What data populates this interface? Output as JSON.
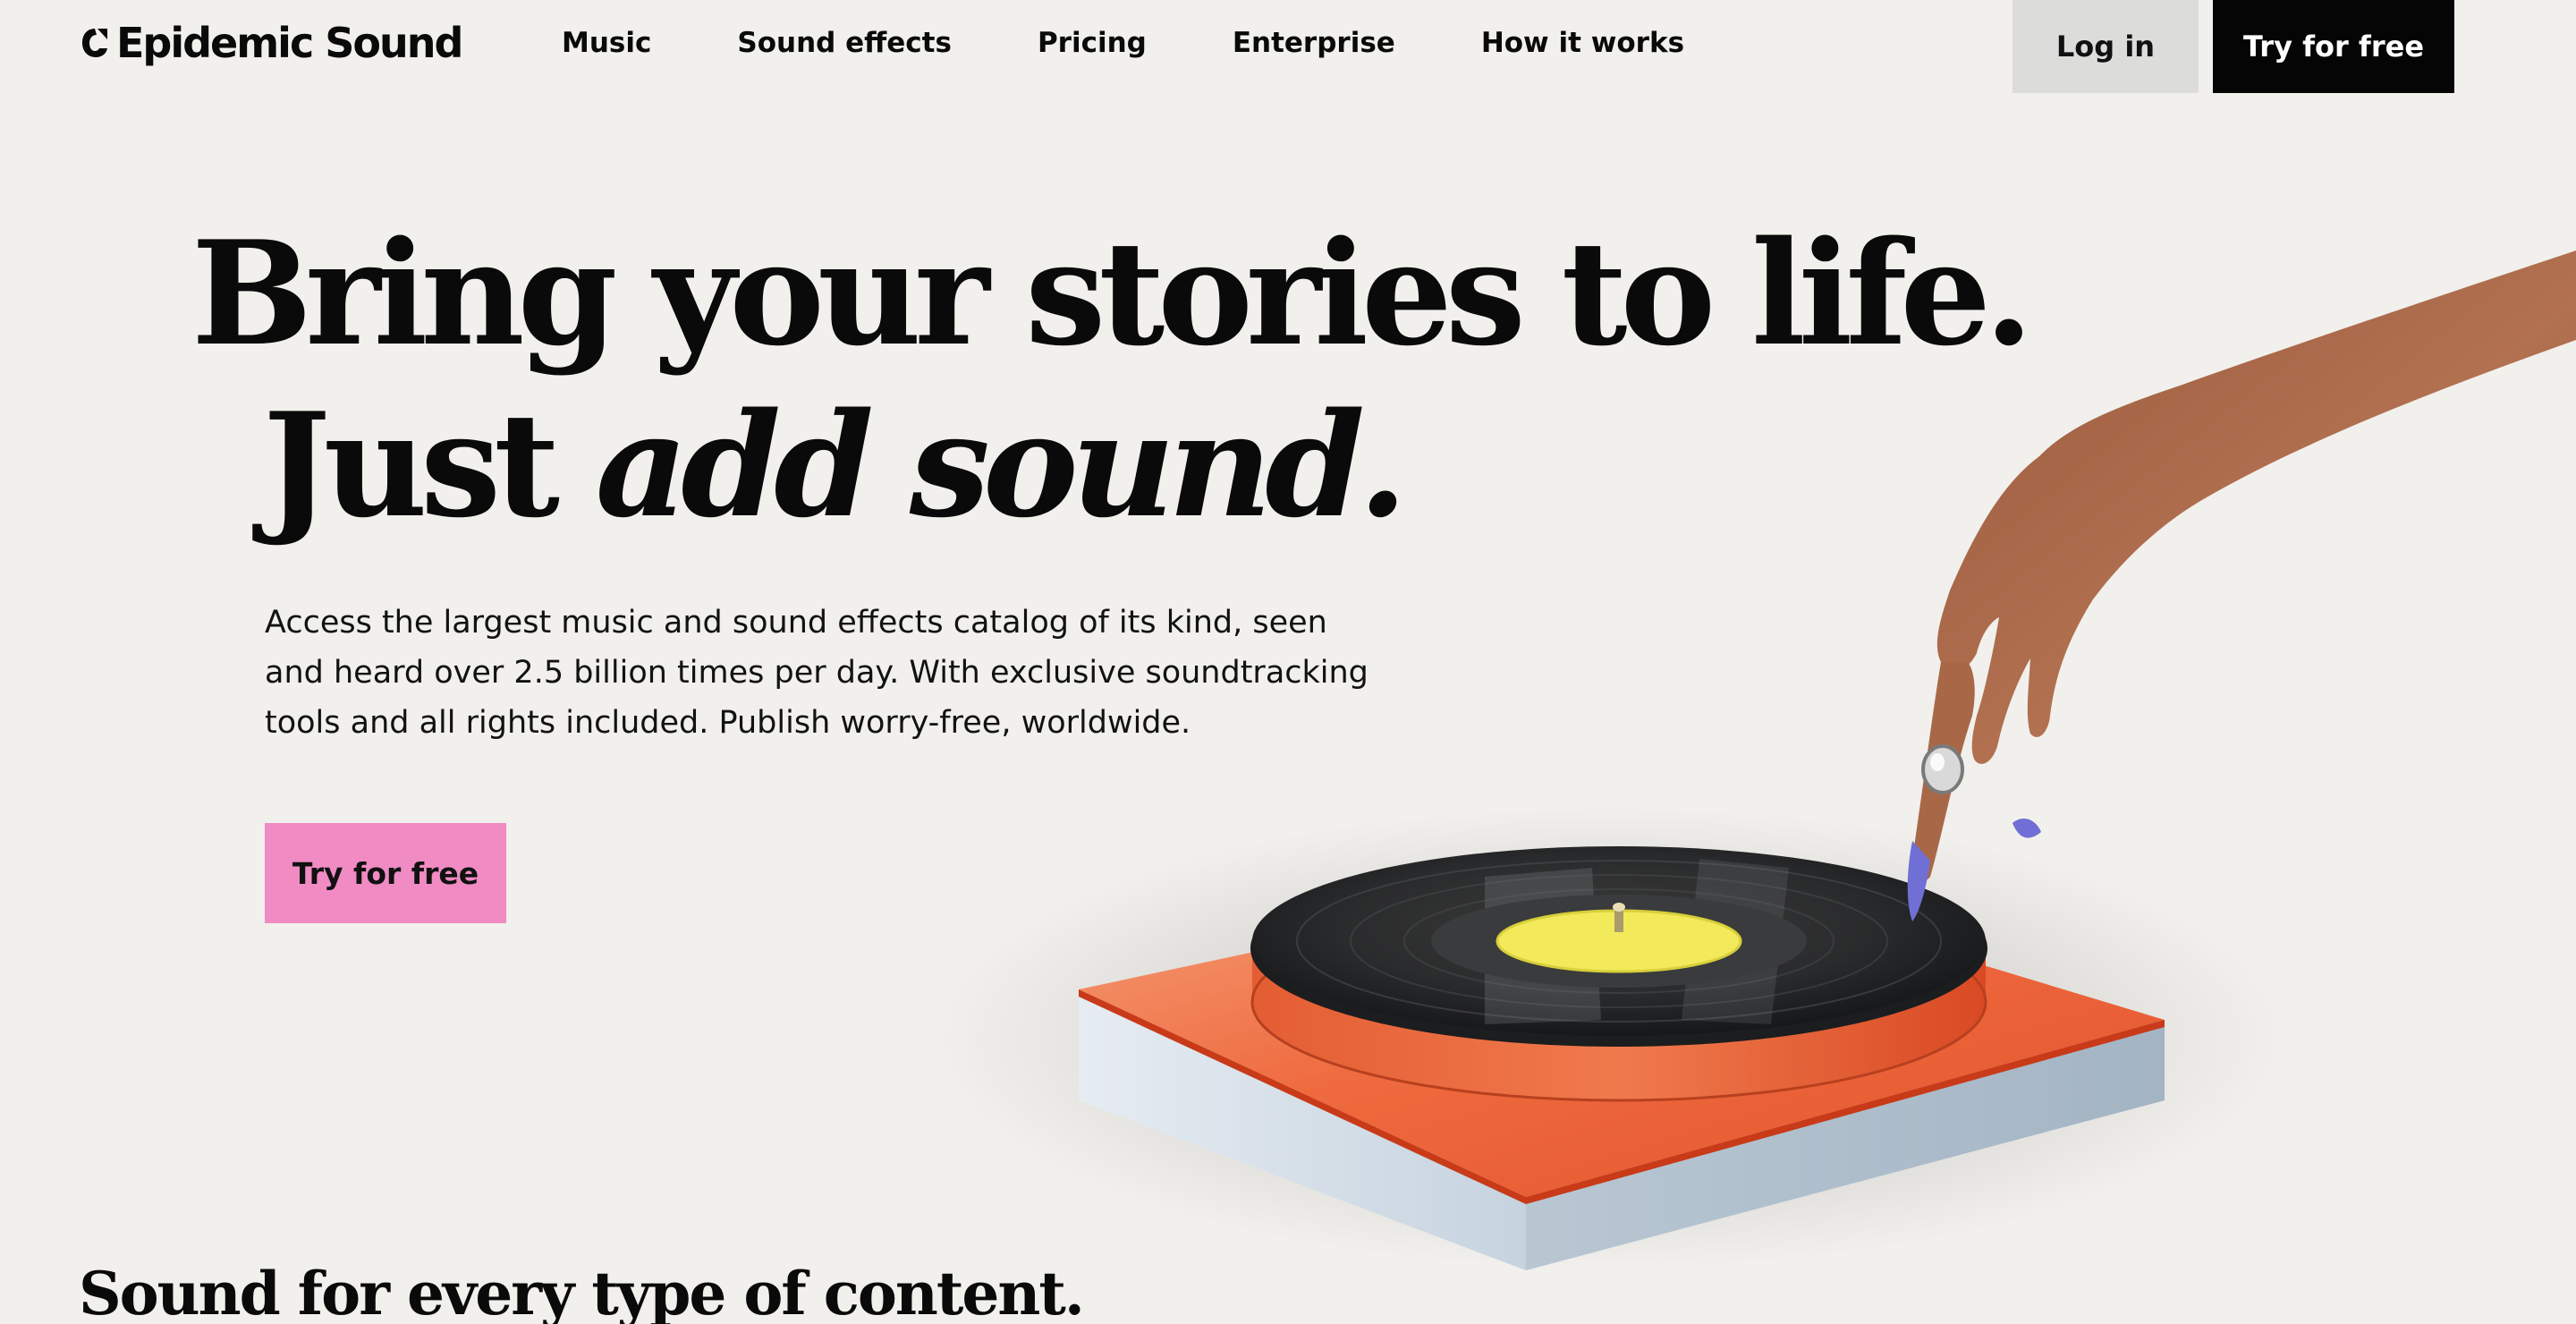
{
  "brand": {
    "name": "Epidemic Sound"
  },
  "nav": {
    "links": [
      "Music",
      "Sound effects",
      "Pricing",
      "Enterprise",
      "How it works"
    ],
    "login_label": "Log in",
    "try_label": "Try for free"
  },
  "hero": {
    "headline_line1": "Bring your stories to life.",
    "headline_line2_plain": "Just",
    "headline_line2_italic": "add sound.",
    "subtext": "Access the largest music and sound effects catalog of its kind, seen and heard over 2.5 billion times per day. With exclusive soundtracking tools and all rights included. Publish worry-free, worldwide.",
    "cta_label": "Try for free"
  },
  "section": {
    "title": "Sound for every type of content."
  },
  "colors": {
    "background": "#f1f0ec",
    "cta_pink": "#f08bc4",
    "nav_cta": "#050505",
    "login_bg": "#dcdcda"
  }
}
